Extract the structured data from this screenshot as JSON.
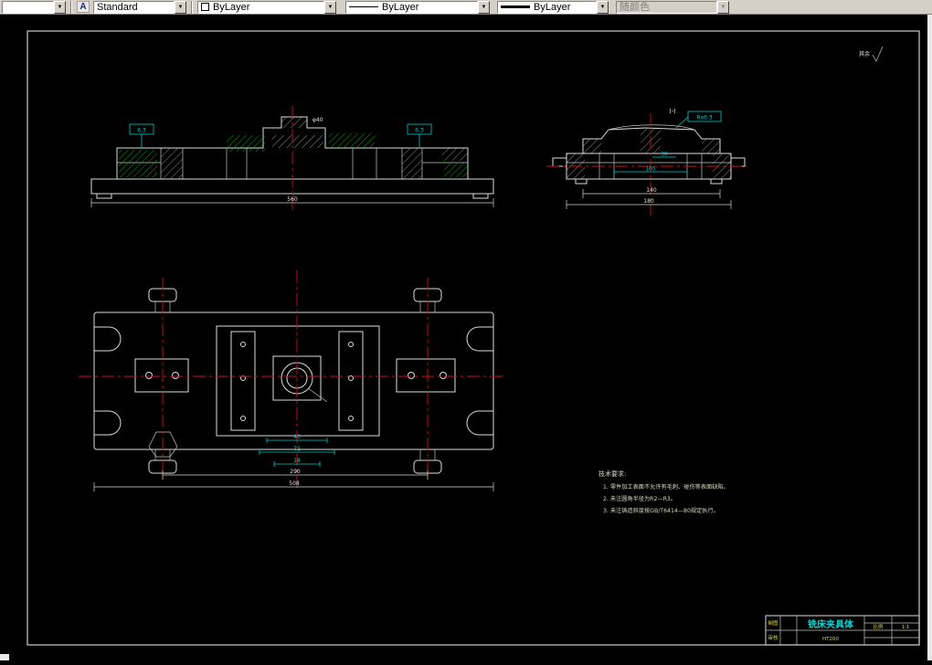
{
  "icons": {
    "chevron_down": "▼",
    "text_style": "A"
  },
  "toolbar": {
    "layer_combo": {
      "value": ""
    },
    "text_style_combo": {
      "value": "Standard"
    },
    "color_combo": {
      "value": "ByLayer"
    },
    "linetype_combo": {
      "value": "ByLayer"
    },
    "lineweight_combo": {
      "value": "ByLayer"
    },
    "plot_style_combo": {
      "value": "随颜色"
    }
  },
  "drawing": {
    "roughness_corner": {
      "label": "其余"
    },
    "section_label": "I-I",
    "surface_flags": {
      "front_left": "6.3",
      "front_right": "6.3",
      "side": "Ra6.3"
    },
    "dims": {
      "front_overall": "560",
      "front_boss": "φ40",
      "side_inner": "105",
      "side_slot": "30",
      "side_base": "140",
      "side_overall": "180",
      "plan_slot_width": "40",
      "plan_slot_depth": "72",
      "plan_slot_gap": "18",
      "plan_bolt_span": "290",
      "plan_overall": "508"
    },
    "tech_requirements": {
      "title": "技术要求:",
      "items": [
        "1. 零件加工表面不允许有毛刺、碰伤等表面缺陷。",
        "2. 未注圆角半径为R2—R3。",
        "3. 未注铸造斜度按GB/T6414—80规定执行。"
      ]
    },
    "title_block": {
      "row1_label": "制图",
      "row2_label": "审核",
      "part_name": "铣床夹具体",
      "material": "HT200",
      "scale_label": "比例",
      "scale_value": "1:1"
    }
  }
}
